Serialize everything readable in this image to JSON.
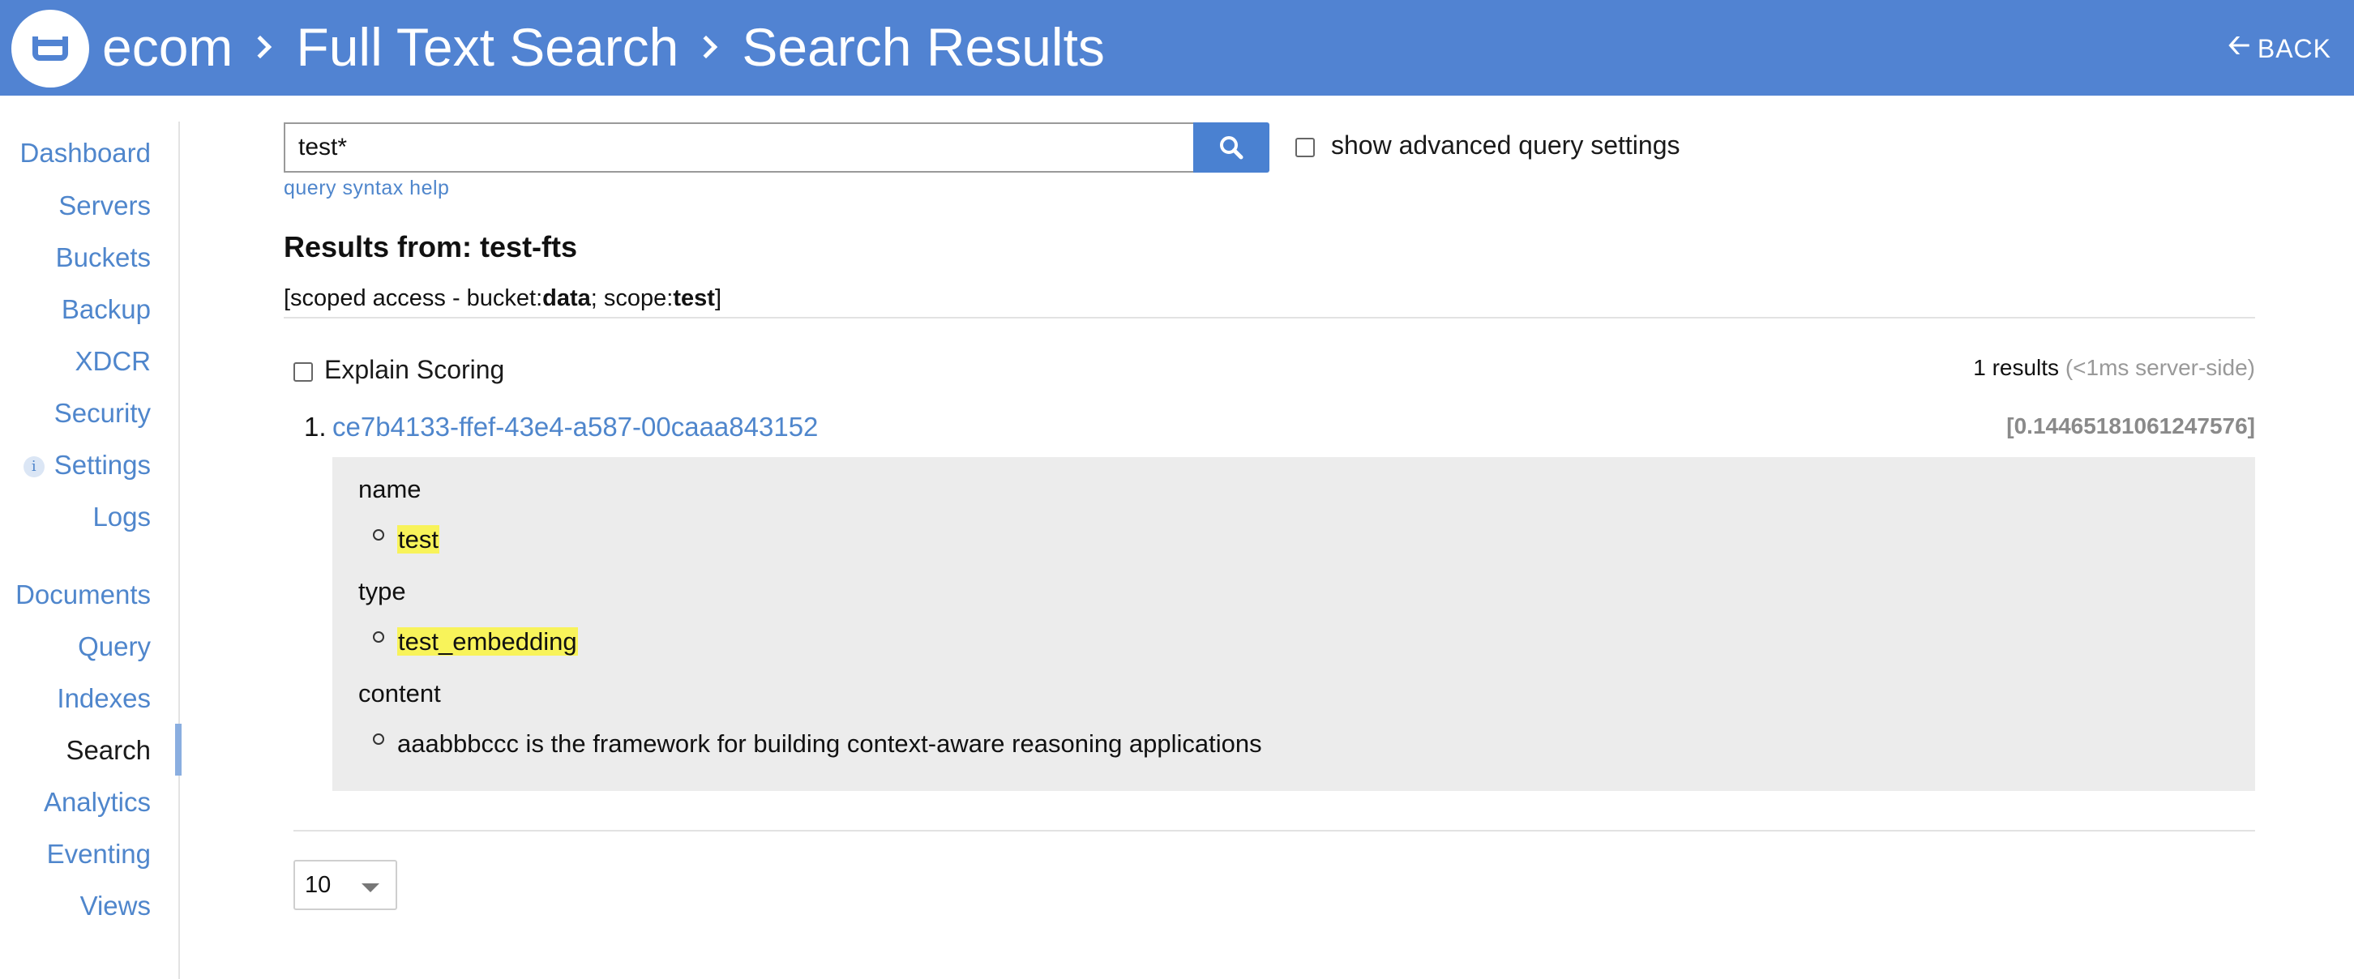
{
  "header": {
    "crumbs": [
      "ecom",
      "Full Text Search",
      "Search Results"
    ],
    "back_label": "BACK",
    "back_icon": "arrow-left-icon",
    "colors": {
      "header_bg": "#5183d2",
      "link": "#4f86cc",
      "highlight": "#f8f35a"
    }
  },
  "sidebar": {
    "items": [
      {
        "label": "Dashboard"
      },
      {
        "label": "Servers"
      },
      {
        "label": "Buckets"
      },
      {
        "label": "Backup"
      },
      {
        "label": "XDCR"
      },
      {
        "label": "Security"
      },
      {
        "label": "Settings",
        "icon": "info-icon",
        "icon_glyph": "i"
      },
      {
        "label": "Logs"
      },
      {
        "label": "Documents"
      },
      {
        "label": "Query"
      },
      {
        "label": "Indexes"
      },
      {
        "label": "Search",
        "active": true
      },
      {
        "label": "Analytics"
      },
      {
        "label": "Eventing"
      },
      {
        "label": "Views"
      }
    ]
  },
  "search": {
    "value": "test*",
    "button_icon": "search-icon",
    "advanced_label": "show advanced query settings",
    "advanced_checked": false,
    "syntax_help": "query syntax help"
  },
  "results": {
    "title": "Results from: test-fts",
    "scoped_prefix": "[scoped access - bucket:",
    "bucket": "data",
    "scope_prefix": "; scope:",
    "scope": "test",
    "scoped_suffix": "]",
    "explain_label": "Explain Scoring",
    "explain_checked": false,
    "count_text": "1 results",
    "timing_text": "(<1ms server-side)",
    "items": [
      {
        "number": "1.",
        "id": "ce7b4133-ffef-43e4-a587-00caaa843152",
        "score": "[0.14465181061247576]",
        "fields": [
          {
            "name": "name",
            "value": "test",
            "highlighted": true
          },
          {
            "name": "type",
            "value": "test_embedding",
            "highlighted": true
          },
          {
            "name": "content",
            "value": "aaabbbccc is the framework for building context-aware reasoning applications",
            "highlighted": false
          }
        ]
      }
    ]
  },
  "pagination": {
    "page_size": "10"
  }
}
